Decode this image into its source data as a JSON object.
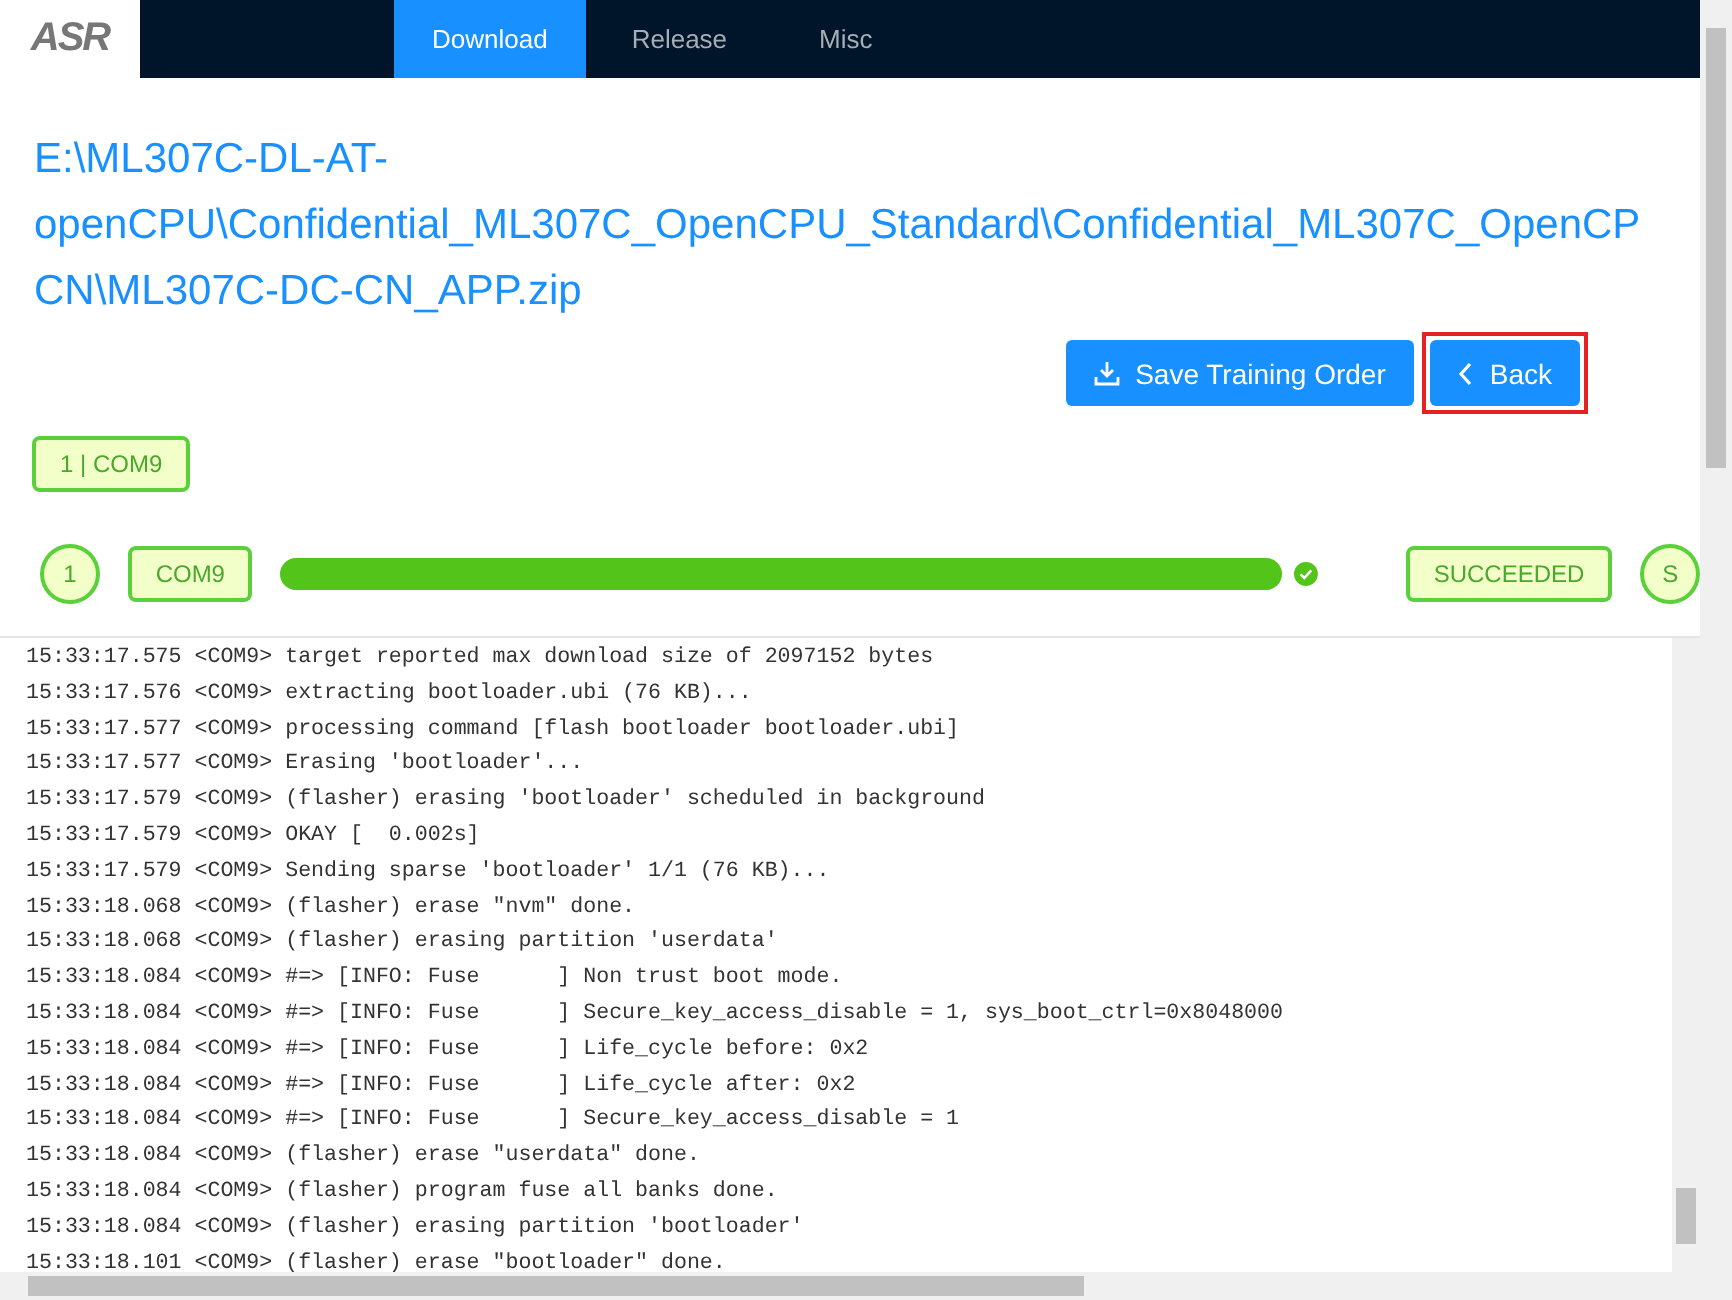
{
  "logo": {
    "text": "ASR"
  },
  "tabs": [
    {
      "label": "Download",
      "selected": true
    },
    {
      "label": "Release",
      "selected": false
    },
    {
      "label": "Misc",
      "selected": false
    }
  ],
  "file_path": [
    "E:\\ML307C-DL-AT-",
    "openCPU\\Confidential_ML307C_OpenCPU_Standard\\Confidential_ML307C_OpenCP",
    "CN\\ML307C-DC-CN_APP.zip"
  ],
  "buttons": [
    {
      "label": "Save Training Order",
      "kind": "save"
    },
    {
      "label": "Back",
      "kind": "back",
      "highlighted": true
    }
  ],
  "port_tag": "1 | COM9",
  "device": {
    "index": "1",
    "port": "COM9",
    "level": 1.0,
    "done": true,
    "status": "SUCCEEDED",
    "status_short": "S"
  },
  "log": [
    "15:33:17.575 <COM9> target reported max download size of 2097152 bytes",
    "15:33:17.576 <COM9> extracting bootloader.ubi (76 KB)...",
    "15:33:17.577 <COM9> processing command [flash bootloader bootloader.ubi]",
    "15:33:17.577 <COM9> Erasing 'bootloader'...",
    "15:33:17.579 <COM9> (flasher) erasing 'bootloader' scheduled in background",
    "15:33:17.579 <COM9> OKAY [  0.002s]",
    "15:33:17.579 <COM9> Sending sparse 'bootloader' 1/1 (76 KB)...",
    "15:33:18.068 <COM9> (flasher) erase \"nvm\" done.",
    "15:33:18.068 <COM9> (flasher) erasing partition 'userdata'",
    "15:33:18.084 <COM9> #=> [INFO: Fuse      ] Non trust boot mode.",
    "15:33:18.084 <COM9> #=> [INFO: Fuse      ] Secure_key_access_disable = 1, sys_boot_ctrl=0x8048000",
    "15:33:18.084 <COM9> #=> [INFO: Fuse      ] Life_cycle before: 0x2",
    "15:33:18.084 <COM9> #=> [INFO: Fuse      ] Life_cycle after: 0x2",
    "15:33:18.084 <COM9> #=> [INFO: Fuse      ] Secure_key_access_disable = 1",
    "15:33:18.084 <COM9> (flasher) erase \"userdata\" done.",
    "15:33:18.084 <COM9> (flasher) program fuse all banks done.",
    "15:33:18.084 <COM9> (flasher) erasing partition 'bootloader'",
    "15:33:18.101 <COM9> (flasher) erase \"bootloader\" done."
  ]
}
